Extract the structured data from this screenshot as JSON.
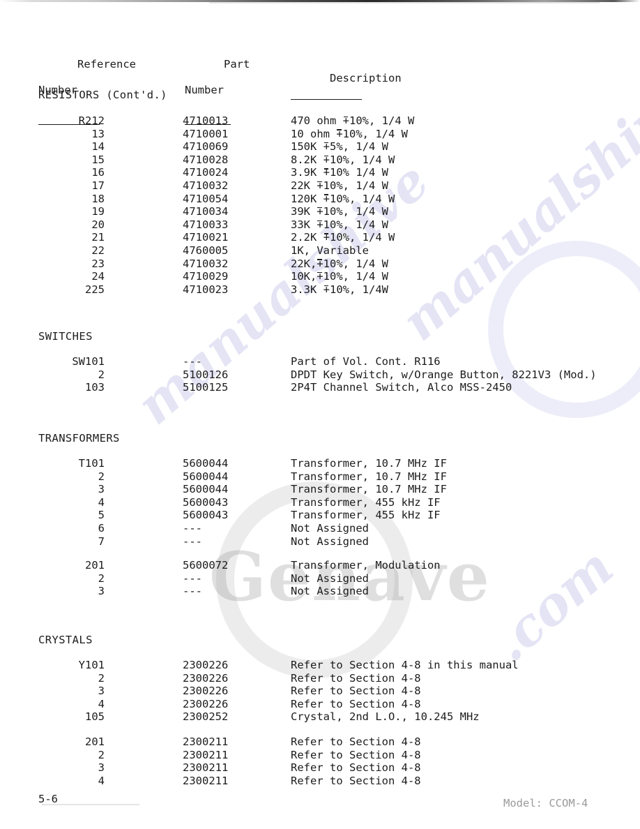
{
  "document": {
    "headers": {
      "reference_line1": "Reference",
      "reference_line2": "Number",
      "part_line1": "Part",
      "part_line2": "Number",
      "description": "Description"
    },
    "footer": {
      "page_number": "5-6",
      "model": "Model: CCOM-4"
    },
    "watermarks": {
      "brand": "Genave",
      "script1": "manualshive",
      "script2": "manualshive",
      "script3": ".com"
    }
  },
  "sections": [
    {
      "title": "RESISTORS (Cont'd.)",
      "groups": [
        {
          "rows": [
            {
              "ref": "R212",
              "part": "4710013",
              "desc_pre": "470 ohm ",
              "desc_pm": "+",
              "desc_post": "10%, 1/4 W"
            },
            {
              "ref": "13",
              "part": "4710001",
              "desc_pre": "10 ohm ",
              "desc_pm": "+",
              "desc_post": "10%, 1/4 W"
            },
            {
              "ref": "14",
              "part": "4710069",
              "desc_pre": "150K ",
              "desc_pm": "+",
              "desc_post": "5%, 1/4 W"
            },
            {
              "ref": "15",
              "part": "4710028",
              "desc_pre": "8.2K ",
              "desc_pm": "+",
              "desc_post": "10%, 1/4 W"
            },
            {
              "ref": "16",
              "part": "4710024",
              "desc_pre": "3.9K ",
              "desc_pm": "+",
              "desc_post": "10% 1/4 W"
            },
            {
              "ref": "17",
              "part": "4710032",
              "desc_pre": "22K ",
              "desc_pm": "+",
              "desc_post": "10%, 1/4 W"
            },
            {
              "ref": "18",
              "part": "4710054",
              "desc_pre": "120K ",
              "desc_pm": "+",
              "desc_post": "10%, 1/4 W"
            },
            {
              "ref": "19",
              "part": "4710034",
              "desc_pre": "39K ",
              "desc_pm": "+",
              "desc_post": "10%, 1/4 W"
            },
            {
              "ref": "20",
              "part": "4710033",
              "desc_pre": "33K ",
              "desc_pm": "+",
              "desc_post": "10%, 1/4 W"
            },
            {
              "ref": "21",
              "part": "4710021",
              "desc_pre": "2.2K ",
              "desc_pm": "+",
              "desc_post": "10%, 1/4 W"
            },
            {
              "ref": "22",
              "part": "4760005",
              "desc_pre": "1K, Variable",
              "desc_pm": "",
              "desc_post": ""
            },
            {
              "ref": "23",
              "part": "4710032",
              "desc_pre": "22K,",
              "desc_pm": "+",
              "desc_post": "10%, 1/4 W"
            },
            {
              "ref": "24",
              "part": "4710029",
              "desc_pre": "10K,",
              "desc_pm": "+",
              "desc_post": "10%, 1/4 W"
            },
            {
              "ref": "225",
              "part": "4710023",
              "desc_pre": "3.3K ",
              "desc_pm": "+",
              "desc_post": "10%, 1/4W"
            }
          ]
        }
      ]
    },
    {
      "title": "SWITCHES",
      "groups": [
        {
          "rows": [
            {
              "ref": "SW101",
              "part": "---",
              "desc_pre": "Part of Vol. Cont. R116",
              "desc_pm": "",
              "desc_post": ""
            },
            {
              "ref": "2",
              "part": "5100126",
              "desc_pre": "DPDT Key Switch, w/Orange Button, 8221V3 (Mod.)",
              "desc_pm": "",
              "desc_post": ""
            },
            {
              "ref": "103",
              "part": "5100125",
              "desc_pre": "2P4T Channel Switch, Alco MSS-2450",
              "desc_pm": "",
              "desc_post": ""
            }
          ]
        }
      ]
    },
    {
      "title": "TRANSFORMERS",
      "groups": [
        {
          "rows": [
            {
              "ref": "T101",
              "part": "5600044",
              "desc_pre": "Transformer, 10.7 MHz IF",
              "desc_pm": "",
              "desc_post": ""
            },
            {
              "ref": "2",
              "part": "5600044",
              "desc_pre": "Transformer, 10.7 MHz IF",
              "desc_pm": "",
              "desc_post": ""
            },
            {
              "ref": "3",
              "part": "5600044",
              "desc_pre": "Transformer, 10.7 MHz IF",
              "desc_pm": "",
              "desc_post": ""
            },
            {
              "ref": "4",
              "part": "5600043",
              "desc_pre": "Transformer, 455 kHz IF",
              "desc_pm": "",
              "desc_post": ""
            },
            {
              "ref": "5",
              "part": "5600043",
              "desc_pre": "Transformer, 455 kHz IF",
              "desc_pm": "",
              "desc_post": ""
            },
            {
              "ref": "6",
              "part": "---",
              "desc_pre": "Not Assigned",
              "desc_pm": "",
              "desc_post": ""
            },
            {
              "ref": "7",
              "part": "---",
              "desc_pre": "Not Assigned",
              "desc_pm": "",
              "desc_post": ""
            }
          ]
        },
        {
          "rows": [
            {
              "ref": "201",
              "part": "5600072",
              "desc_pre": "Transformer, Modulation",
              "desc_pm": "",
              "desc_post": ""
            },
            {
              "ref": "2",
              "part": "---",
              "desc_pre": "Not Assigned",
              "desc_pm": "",
              "desc_post": ""
            },
            {
              "ref": "3",
              "part": "---",
              "desc_pre": "Not Assigned",
              "desc_pm": "",
              "desc_post": ""
            }
          ]
        }
      ]
    },
    {
      "title": "CRYSTALS",
      "groups": [
        {
          "rows": [
            {
              "ref": "Y101",
              "part": "2300226",
              "desc_pre": "Refer to Section 4-8 in this manual",
              "desc_pm": "",
              "desc_post": ""
            },
            {
              "ref": "2",
              "part": "2300226",
              "desc_pre": "Refer to Section 4-8",
              "desc_pm": "",
              "desc_post": ""
            },
            {
              "ref": "3",
              "part": "2300226",
              "desc_pre": "Refer to Section 4-8",
              "desc_pm": "",
              "desc_post": ""
            },
            {
              "ref": "4",
              "part": "2300226",
              "desc_pre": "Refer to Section 4-8",
              "desc_pm": "",
              "desc_post": ""
            },
            {
              "ref": "105",
              "part": "2300252",
              "desc_pre": "Crystal, 2nd L.O., 10.245 MHz",
              "desc_pm": "",
              "desc_post": ""
            }
          ]
        },
        {
          "rows": [
            {
              "ref": "201",
              "part": "2300211",
              "desc_pre": "Refer to Section 4-8",
              "desc_pm": "",
              "desc_post": ""
            },
            {
              "ref": "2",
              "part": "2300211",
              "desc_pre": "Refer to Section 4-8",
              "desc_pm": "",
              "desc_post": ""
            },
            {
              "ref": "3",
              "part": "2300211",
              "desc_pre": "Refer to Section 4-8",
              "desc_pm": "",
              "desc_post": ""
            },
            {
              "ref": "4",
              "part": "2300211",
              "desc_pre": "Refer to Section 4-8",
              "desc_pm": "",
              "desc_post": ""
            }
          ]
        }
      ]
    }
  ],
  "layout": {
    "section_tops": [
      127,
      473,
      619,
      908
    ],
    "group_tops": [
      [
        164
      ],
      [
        509
      ],
      [
        655,
        801
      ],
      [
        944,
        1054
      ]
    ]
  }
}
